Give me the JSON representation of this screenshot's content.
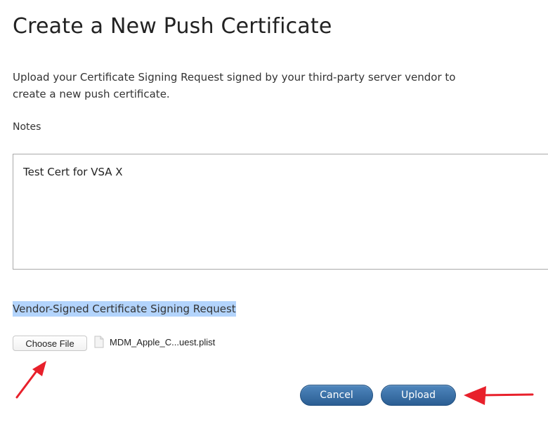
{
  "page": {
    "title": "Create a New Push Certificate",
    "description": "Upload your Certificate Signing Request signed by your third-party server vendor to create a new push certificate."
  },
  "notes": {
    "label": "Notes",
    "value": "Test Cert for VSA X"
  },
  "csr": {
    "label": "Vendor-Signed Certificate Signing Request",
    "choose_file_label": "Choose File",
    "file_name": "MDM_Apple_C...uest.plist"
  },
  "actions": {
    "cancel_label": "Cancel",
    "upload_label": "Upload"
  },
  "colors": {
    "button_blue": "#2b5e93",
    "highlight": "#b3d4fc",
    "annotation_arrow": "#e8202b"
  },
  "annotations": [
    {
      "icon": "arrow-icon",
      "points_to": "choose-file-button"
    },
    {
      "icon": "arrow-icon",
      "points_to": "upload-button"
    }
  ]
}
